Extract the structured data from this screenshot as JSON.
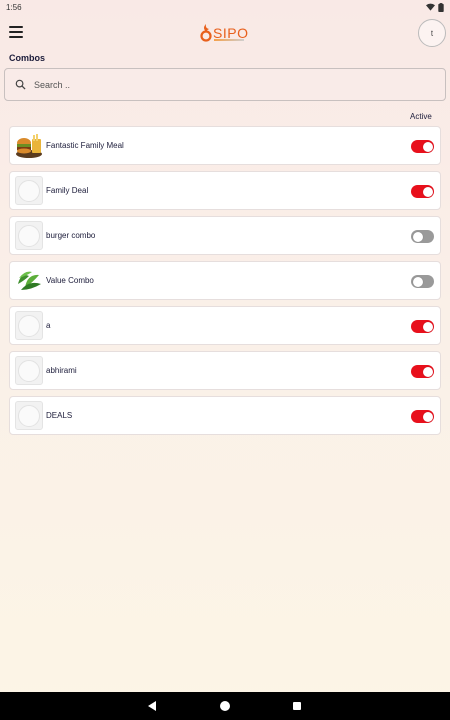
{
  "status_bar": {
    "time": "1:56"
  },
  "header": {
    "logo_text": "SIPO",
    "avatar_letter": "t"
  },
  "page": {
    "title": "Combos",
    "search_placeholder": "Search ..",
    "column_active": "Active"
  },
  "combos": [
    {
      "name": "Fantastic Family Meal",
      "image": "burger-meal",
      "active": true
    },
    {
      "name": "Family Deal",
      "image": "placeholder-plate",
      "active": true
    },
    {
      "name": "burger combo",
      "image": "placeholder-plate",
      "active": false
    },
    {
      "name": "Value Combo",
      "image": "leafy-greens",
      "active": false
    },
    {
      "name": "a",
      "image": "placeholder-plate",
      "active": true
    },
    {
      "name": "abhirami",
      "image": "placeholder-plate",
      "active": true
    },
    {
      "name": "DEALS",
      "image": "placeholder-plate",
      "active": true
    }
  ],
  "colors": {
    "accent": "#e8101c",
    "logo": "#e8601c",
    "toggle_off": "#9a9a9a"
  }
}
